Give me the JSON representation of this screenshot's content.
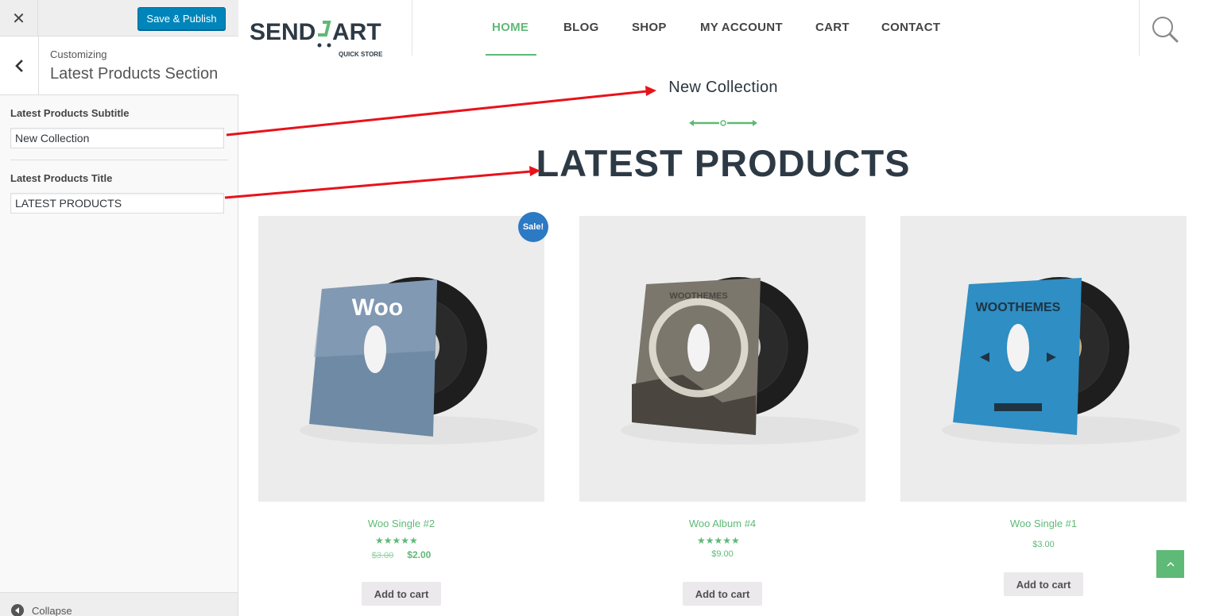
{
  "panel": {
    "close_glyph": "✕",
    "publish_label": "Save & Publish",
    "crumb": "Customizing",
    "section_title": "Latest Products Section",
    "controls": [
      {
        "label": "Latest Products Subtitle",
        "value": "New Collection"
      },
      {
        "label": "Latest Products Title",
        "value": "LATEST PRODUCTS"
      }
    ],
    "collapse_label": "Collapse"
  },
  "site": {
    "logo": {
      "brand_left": "SEND",
      "brand_right": "ART",
      "tagline": "QUICK STORE",
      "brand_color": "#5fb977",
      "text_color": "#2d3a45"
    },
    "nav": [
      "HOME",
      "BLOG",
      "SHOP",
      "MY ACCOUNT",
      "CART",
      "CONTACT"
    ],
    "active_nav": "HOME",
    "section": {
      "subtitle": "New Collection",
      "title": "LATEST PRODUCTS"
    },
    "products": [
      {
        "name": "Woo Single #2",
        "sale_badge": "Sale!",
        "rating": 4.5,
        "stars": "★★★★★",
        "old_price": "$3.00",
        "price": "$2.00",
        "button": "Add to cart",
        "cover": "Woo",
        "cover_color": "#6f8aa5"
      },
      {
        "name": "Woo Album #4",
        "rating": 5,
        "stars": "★★★★★",
        "price": "$9.00",
        "button": "Add to cart",
        "cover": "WOOTHEMES",
        "cover_color": "#7b776d"
      },
      {
        "name": "Woo Single #1",
        "price": "$3.00",
        "button": "Add to cart",
        "cover": "WOOTHEMES",
        "cover_color": "#2f8ec3"
      }
    ]
  },
  "colors": {
    "accent": "#5fb977",
    "publish": "#0085ba",
    "sale": "#2c79c4",
    "annotation": "#e8121a"
  }
}
